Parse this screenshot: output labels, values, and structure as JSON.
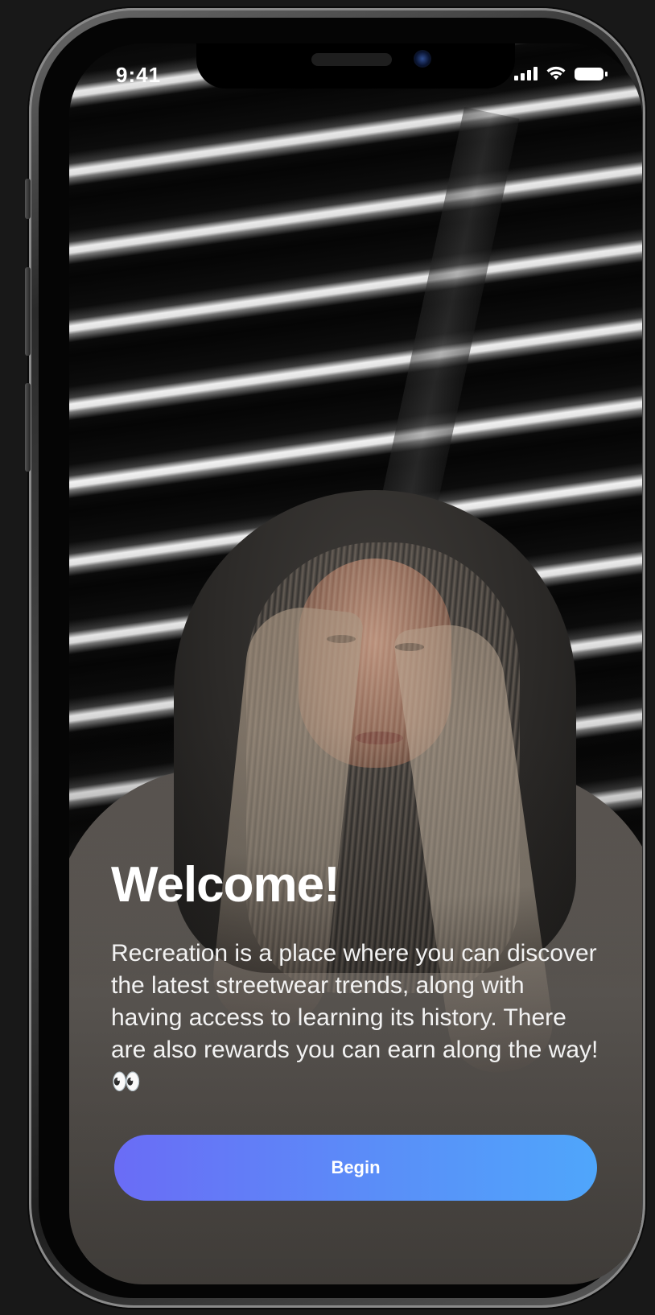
{
  "status_bar": {
    "time": "9:41"
  },
  "welcome": {
    "title": "Welcome!",
    "description": "Recreation is a place where you can discover the latest streetwear trends, along with having access to learning its history. There are also rewards you can earn along the way! 👀"
  },
  "actions": {
    "begin_label": "Begin"
  },
  "colors": {
    "button_gradient_start": "#6a6cf6",
    "button_gradient_end": "#4fa6fb"
  }
}
